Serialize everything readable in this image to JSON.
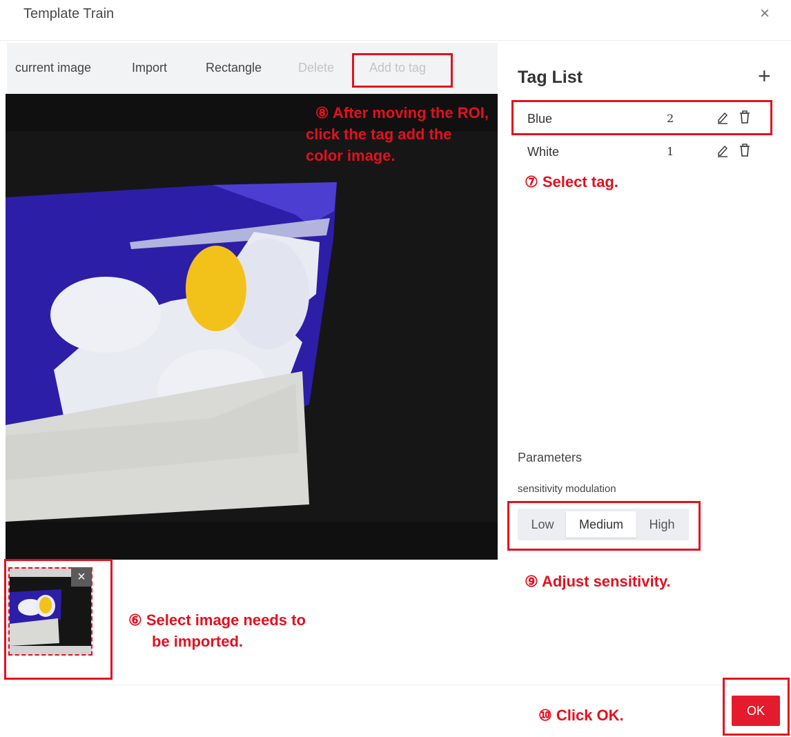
{
  "dialog": {
    "title": "Template Train",
    "close_glyph": "×"
  },
  "toolbar": {
    "items": [
      {
        "label": "current image",
        "enabled": true
      },
      {
        "label": "Import",
        "enabled": true
      },
      {
        "label": "Rectangle",
        "enabled": true
      },
      {
        "label": "Delete",
        "enabled": false
      },
      {
        "label": "Add to tag",
        "enabled": false
      }
    ]
  },
  "tag_list": {
    "title": "Tag List",
    "add_glyph": "+",
    "tags": [
      {
        "name": "Blue",
        "count": "2"
      },
      {
        "name": "White",
        "count": "1"
      }
    ]
  },
  "parameters": {
    "title": "Parameters",
    "sensitivity_label": "sensitivity modulation",
    "options": [
      "Low",
      "Medium",
      "High"
    ],
    "selected": "Medium"
  },
  "thumbnail": {
    "close_glyph": "×"
  },
  "footer": {
    "ok_label": "OK"
  },
  "annotations": {
    "step6": [
      "⑥ Select image needs to",
      "be imported."
    ],
    "step7": "⑦ Select tag.",
    "step8": [
      "⑧ After moving the ROI,",
      "click the tag add the",
      "color image."
    ],
    "step9": "⑨ Adjust sensitivity.",
    "step10": "⑩ Click OK."
  },
  "colors": {
    "accent": "#e31b2c",
    "annotation": "#e3101e",
    "toolbar_bg": "#f2f3f5",
    "package_blue": "#2d1ea8",
    "flower_center": "#f3c21a"
  },
  "icons": {
    "edit": "pencil-icon",
    "delete": "trash-icon"
  }
}
